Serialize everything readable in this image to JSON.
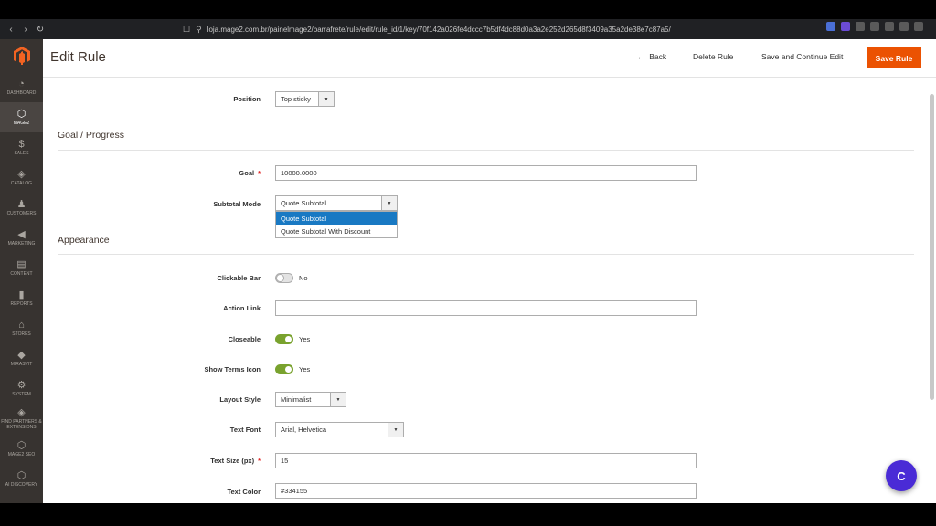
{
  "browser": {
    "url": "loja.mage2.com.br/painelmage2/barrafrete/rule/edit/rule_id/1/key/70f142a026fe4dccc7b5df4dc88d0a3a2e252d265d8f3409a35a2de38e7c87a5/"
  },
  "sidebar": {
    "items": [
      {
        "label": "DASHBOARD",
        "icon": "dashboard-icon",
        "glyph": "◔"
      },
      {
        "label": "MAGE2",
        "icon": "hexagon-icon",
        "glyph": "⬡"
      },
      {
        "label": "SALES",
        "icon": "dollar-icon",
        "glyph": "$"
      },
      {
        "label": "CATALOG",
        "icon": "cube-icon",
        "glyph": "◈"
      },
      {
        "label": "CUSTOMERS",
        "icon": "person-icon",
        "glyph": "♟"
      },
      {
        "label": "MARKETING",
        "icon": "megaphone-icon",
        "glyph": "◀"
      },
      {
        "label": "CONTENT",
        "icon": "content-icon",
        "glyph": "▤"
      },
      {
        "label": "REPORTS",
        "icon": "bar-chart-icon",
        "glyph": "▮"
      },
      {
        "label": "STORES",
        "icon": "store-icon",
        "glyph": "⌂"
      },
      {
        "label": "MIRASVIT",
        "icon": "diamond-icon",
        "glyph": "◆"
      },
      {
        "label": "SYSTEM",
        "icon": "gear-icon",
        "glyph": "⚙"
      },
      {
        "label": "FIND PARTNERS & EXTENSIONS",
        "icon": "partners-icon",
        "glyph": "◈"
      },
      {
        "label": "MAGE2 SEO",
        "icon": "hexagon-icon",
        "glyph": "⬡"
      },
      {
        "label": "AI DISCOVERY",
        "icon": "hexagon-icon",
        "glyph": "⬡"
      }
    ]
  },
  "header": {
    "title": "Edit Rule",
    "back": "Back",
    "delete": "Delete Rule",
    "save_continue": "Save and Continue Edit",
    "save": "Save Rule"
  },
  "form": {
    "position_label": "Position",
    "position_value": "Top sticky",
    "goal_section": "Goal / Progress",
    "goal_label": "Goal",
    "goal_value": "10000.0000",
    "subtotal_label": "Subtotal Mode",
    "subtotal_value": "Quote Subtotal",
    "subtotal_options": [
      "Quote Subtotal",
      "Quote Subtotal With Discount"
    ],
    "appearance_section": "Appearance",
    "clickable_label": "Clickable Bar",
    "clickable_value": "No",
    "action_label": "Action Link",
    "action_value": "",
    "closeable_label": "Closeable",
    "closeable_value": "Yes",
    "terms_label": "Show Terms Icon",
    "terms_value": "Yes",
    "layout_label": "Layout Style",
    "layout_value": "Minimalist",
    "font_label": "Text Font",
    "font_value": "Arial, Helvetica",
    "size_label": "Text Size (px)",
    "size_value": "15",
    "color_label": "Text Color",
    "color_value": "#334155"
  },
  "chat": {
    "label": "C"
  },
  "colors": {
    "accent": "#eb5202",
    "toggle_on": "#79a22e",
    "selected": "#1979c3",
    "sidebar": "#373330"
  }
}
